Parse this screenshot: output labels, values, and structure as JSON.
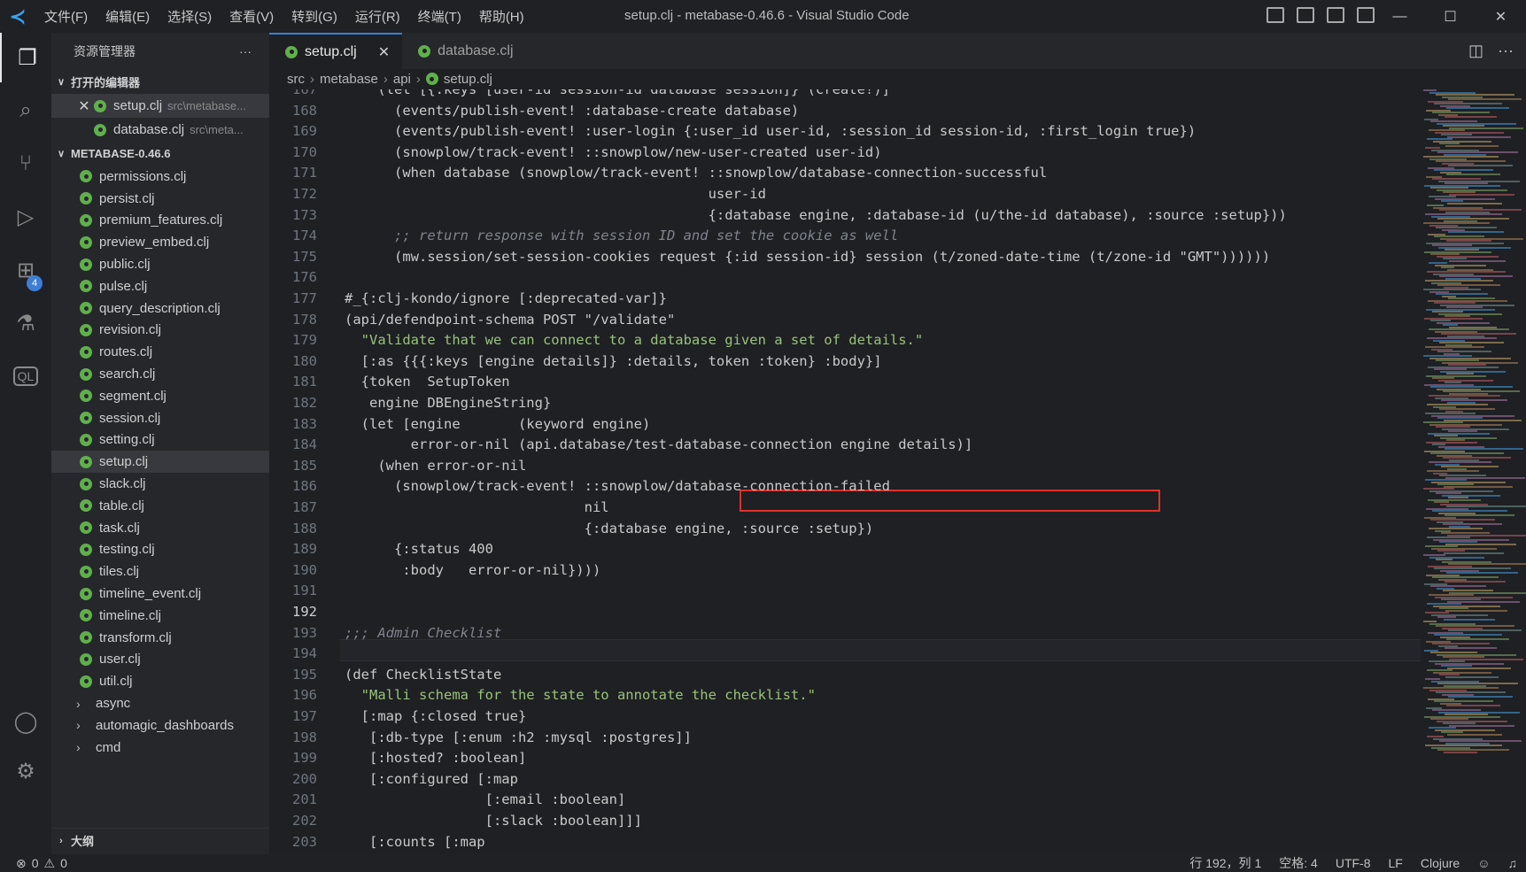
{
  "titlebar": {
    "menu": [
      "文件(F)",
      "编辑(E)",
      "选择(S)",
      "查看(V)",
      "转到(G)",
      "运行(R)",
      "终端(T)",
      "帮助(H)"
    ],
    "title": "setup.clj - metabase-0.46.6 - Visual Studio Code"
  },
  "activity": {
    "extensions_badge": "4"
  },
  "sidebar": {
    "header": "资源管理器",
    "more": "···",
    "open_editors_label": "打开的编辑器",
    "open_editors": [
      {
        "name": "setup.clj",
        "desc": "src\\metabase..."
      },
      {
        "name": "database.clj",
        "desc": "src\\meta..."
      }
    ],
    "project_label": "METABASE-0.46.6",
    "files": [
      "permissions.clj",
      "persist.clj",
      "premium_features.clj",
      "preview_embed.clj",
      "public.clj",
      "pulse.clj",
      "query_description.clj",
      "revision.clj",
      "routes.clj",
      "search.clj",
      "segment.clj",
      "session.clj",
      "setting.clj",
      "setup.clj",
      "slack.clj",
      "table.clj",
      "task.clj",
      "testing.clj",
      "tiles.clj",
      "timeline_event.clj",
      "timeline.clj",
      "transform.clj",
      "user.clj",
      "util.clj"
    ],
    "folders": [
      "async",
      "automagic_dashboards",
      "cmd"
    ],
    "outline_label": "大纲"
  },
  "tabs": [
    {
      "label": "setup.clj"
    },
    {
      "label": "database.clj"
    }
  ],
  "breadcrumb": [
    "src",
    "metabase",
    "api",
    "setup.clj"
  ],
  "status": {
    "errors": "0",
    "warnings": "0",
    "position": "行 192，列 1",
    "indent": "空格: 4",
    "encoding": "UTF-8",
    "eol": "LF",
    "language": "Clojure"
  },
  "code": {
    "current_line": 192,
    "lines": [
      {
        "n": "167",
        "t": "    (let [{:keys [user-id session-id database session]} (create!)]"
      },
      {
        "n": "168",
        "t": "      (events/publish-event! :database-create database)"
      },
      {
        "n": "169",
        "t": "      (events/publish-event! :user-login {:user_id user-id, :session_id session-id, :first_login true})"
      },
      {
        "n": "170",
        "t": "      (snowplow/track-event! ::snowplow/new-user-created user-id)"
      },
      {
        "n": "171",
        "t": "      (when database (snowplow/track-event! ::snowplow/database-connection-successful"
      },
      {
        "n": "172",
        "t": "                                            user-id"
      },
      {
        "n": "173",
        "t": "                                            {:database engine, :database-id (u/the-id database), :source :setup}))"
      },
      {
        "n": "174",
        "t": "      ;; return response with session ID and set the cookie as well"
      },
      {
        "n": "175",
        "t": "      (mw.session/set-session-cookies request {:id session-id} session (t/zoned-date-time (t/zone-id \"GMT\"))))))"
      },
      {
        "n": "176",
        "t": ""
      },
      {
        "n": "177",
        "t": "#_{:clj-kondo/ignore [:deprecated-var]}"
      },
      {
        "n": "178",
        "t": "(api/defendpoint-schema POST \"/validate\""
      },
      {
        "n": "179",
        "t": "  \"Validate that we can connect to a database given a set of details.\""
      },
      {
        "n": "180",
        "t": "  [:as {{{:keys [engine details]} :details, token :token} :body}]"
      },
      {
        "n": "181",
        "t": "  {token  SetupToken"
      },
      {
        "n": "182",
        "t": "   engine DBEngineString}"
      },
      {
        "n": "183",
        "t": "  (let [engine       (keyword engine)"
      },
      {
        "n": "184",
        "t": "        error-or-nil (api.database/test-database-connection engine details)]"
      },
      {
        "n": "185",
        "t": "    (when error-or-nil"
      },
      {
        "n": "186",
        "t": "      (snowplow/track-event! ::snowplow/database-connection-failed"
      },
      {
        "n": "187",
        "t": "                             nil"
      },
      {
        "n": "188",
        "t": "                             {:database engine, :source :setup})"
      },
      {
        "n": "189",
        "t": "      {:status 400"
      },
      {
        "n": "190",
        "t": "       :body   error-or-nil})))"
      },
      {
        "n": "191",
        "t": ""
      },
      {
        "n": "192",
        "t": ""
      },
      {
        "n": "193",
        "t": ";;; Admin Checklist"
      },
      {
        "n": "194",
        "t": ""
      },
      {
        "n": "195",
        "t": "(def ChecklistState"
      },
      {
        "n": "196",
        "t": "  \"Malli schema for the state to annotate the checklist.\""
      },
      {
        "n": "197",
        "t": "  [:map {:closed true}"
      },
      {
        "n": "198",
        "t": "   [:db-type [:enum :h2 :mysql :postgres]]"
      },
      {
        "n": "199",
        "t": "   [:hosted? :boolean]"
      },
      {
        "n": "200",
        "t": "   [:configured [:map"
      },
      {
        "n": "201",
        "t": "                 [:email :boolean]"
      },
      {
        "n": "202",
        "t": "                 [:slack :boolean]]]"
      },
      {
        "n": "203",
        "t": "   [:counts [:map"
      }
    ]
  }
}
